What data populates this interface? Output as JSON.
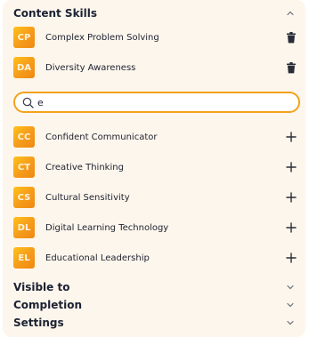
{
  "content_skills": {
    "title": "Content Skills",
    "selected": [
      {
        "initials": "CP",
        "name": "Complex Problem Solving"
      },
      {
        "initials": "DA",
        "name": "Diversity Awareness"
      }
    ],
    "search": {
      "value": "e",
      "placeholder": ""
    },
    "results": [
      {
        "initials": "CC",
        "name": "Confident Communicator"
      },
      {
        "initials": "CT",
        "name": "Creative Thinking"
      },
      {
        "initials": "CS",
        "name": "Cultural Sensitivity"
      },
      {
        "initials": "DL",
        "name": "Digital Learning Technology"
      },
      {
        "initials": "EL",
        "name": "Educational Leadership"
      }
    ]
  },
  "sections": {
    "visible_to": "Visible to",
    "completion": "Completion",
    "settings": "Settings"
  },
  "colors": {
    "panel_bg": "#fdf6ec",
    "accent": "#f2a21b",
    "badge_gradient_start": "#ffc21a",
    "badge_gradient_end": "#ef8a12"
  },
  "icons": {
    "collapse": "chevron-up-icon",
    "expand": "chevron-down-icon",
    "remove": "trash-icon",
    "add": "plus-icon",
    "search": "search-icon"
  }
}
